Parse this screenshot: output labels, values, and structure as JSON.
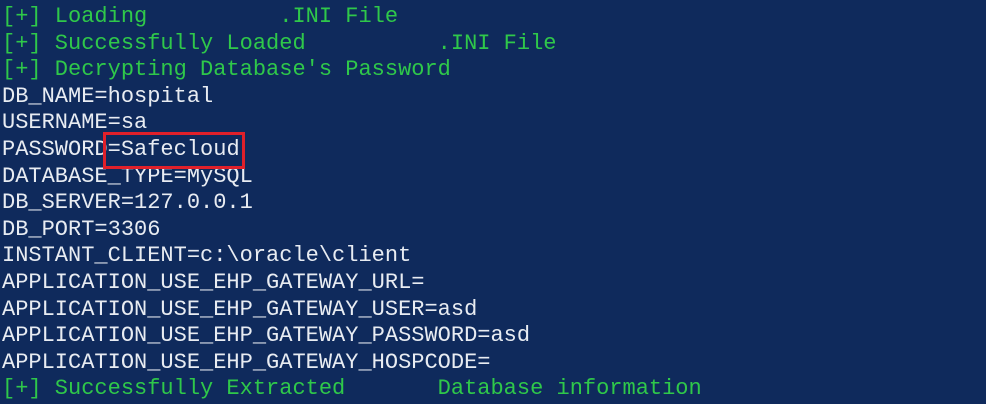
{
  "terminal": {
    "lines": [
      {
        "text": "[+] Loading          .INI File",
        "color": "green"
      },
      {
        "text": "[+] Successfully Loaded          .INI File",
        "color": "green"
      },
      {
        "text": "[+] Decrypting Database's Password",
        "color": "green"
      },
      {
        "text": "DB_NAME=hospital",
        "color": "white"
      },
      {
        "text": "USERNAME=sa",
        "color": "white"
      },
      {
        "key": "PASSWORD",
        "value": "=Safecloud",
        "color": "white",
        "highlight": true
      },
      {
        "text": "DATABASE_TYPE=MySQL",
        "color": "white"
      },
      {
        "text": "DB_SERVER=127.0.0.1",
        "color": "white"
      },
      {
        "text": "DB_PORT=3306",
        "color": "white"
      },
      {
        "text": "INSTANT_CLIENT=c:\\oracle\\client",
        "color": "white"
      },
      {
        "text": "APPLICATION_USE_EHP_GATEWAY_URL=",
        "color": "white"
      },
      {
        "text": "APPLICATION_USE_EHP_GATEWAY_USER=asd",
        "color": "white"
      },
      {
        "text": "APPLICATION_USE_EHP_GATEWAY_PASSWORD=asd",
        "color": "white"
      },
      {
        "text": "APPLICATION_USE_EHP_GATEWAY_HOSPCODE=",
        "color": "white"
      },
      {
        "text": "[+] Successfully Extracted       Database information",
        "color": "green"
      }
    ],
    "colors": {
      "background": "#0f2a5c",
      "green": "#2fc84a",
      "white": "#e8ecf2",
      "highlight": "#e0202a"
    }
  }
}
